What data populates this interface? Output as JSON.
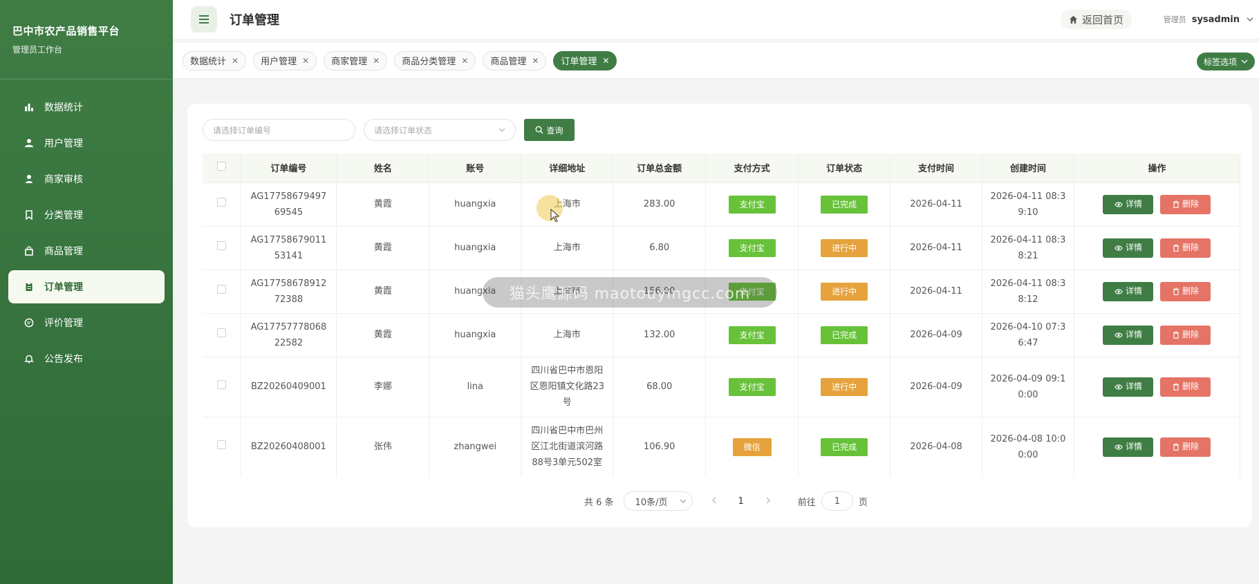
{
  "sidebar": {
    "title": "巴中市农产品销售平台",
    "subtitle": "管理员工作台",
    "items": [
      {
        "label": "数据统计",
        "icon": "bar-chart-icon"
      },
      {
        "label": "用户管理",
        "icon": "user-icon"
      },
      {
        "label": "商家审核",
        "icon": "merchant-icon"
      },
      {
        "label": "分类管理",
        "icon": "bookmark-icon"
      },
      {
        "label": "商品管理",
        "icon": "bag-icon"
      },
      {
        "label": "订单管理",
        "icon": "clipboard-icon",
        "active": true
      },
      {
        "label": "评价管理",
        "icon": "chat-icon"
      },
      {
        "label": "公告发布",
        "icon": "bell-icon"
      }
    ]
  },
  "header": {
    "title": "订单管理",
    "home_label": "返回首页",
    "role": "管理员",
    "username": "sysadmin"
  },
  "tags": {
    "items": [
      "数据统计",
      "用户管理",
      "商家管理",
      "商品分类管理",
      "商品管理",
      "订单管理"
    ],
    "active_index": 5,
    "options_label": "标签选项"
  },
  "filters": {
    "order_no_placeholder": "请选择订单编号",
    "status_placeholder": "请选择订单状态",
    "query_label": "查询"
  },
  "table": {
    "columns": [
      "订单编号",
      "姓名",
      "账号",
      "详细地址",
      "订单总金额",
      "支付方式",
      "订单状态",
      "支付时间",
      "创建时间",
      "操作"
    ],
    "rows": [
      {
        "order_no": "AG1775867949769545",
        "name": "黄霞",
        "account": "huangxia",
        "address": "上海市",
        "amount": "283.00",
        "pay_method": "支付宝",
        "status": "已完成",
        "pay_time": "2026-04-11",
        "created": "2026-04-11 08:39:10"
      },
      {
        "order_no": "AG1775867901153141",
        "name": "黄霞",
        "account": "huangxia",
        "address": "上海市",
        "amount": "6.80",
        "pay_method": "支付宝",
        "status": "进行中",
        "pay_time": "2026-04-11",
        "created": "2026-04-11 08:38:21"
      },
      {
        "order_no": "AG1775867891272388",
        "name": "黄霞",
        "account": "huangxia",
        "address": "上海市",
        "amount": "156.00",
        "pay_method": "支付宝",
        "status": "进行中",
        "pay_time": "2026-04-11",
        "created": "2026-04-11 08:38:12"
      },
      {
        "order_no": "AG1775777806822582",
        "name": "黄霞",
        "account": "huangxia",
        "address": "上海市",
        "amount": "132.00",
        "pay_method": "支付宝",
        "status": "已完成",
        "pay_time": "2026-04-09",
        "created": "2026-04-10 07:36:47"
      },
      {
        "order_no": "BZ20260409001",
        "name": "李娜",
        "account": "lina",
        "address": "四川省巴中市恩阳区恩阳镇文化路23号",
        "amount": "68.00",
        "pay_method": "支付宝",
        "status": "进行中",
        "pay_time": "2026-04-09",
        "created": "2026-04-09 09:10:00"
      },
      {
        "order_no": "BZ20260408001",
        "name": "张伟",
        "account": "zhangwei",
        "address": "四川省巴中市巴州区江北街道滨河路88号3单元502室",
        "amount": "106.90",
        "pay_method": "微信",
        "status": "已完成",
        "pay_time": "2026-04-08",
        "created": "2026-04-08 10:00:00"
      }
    ],
    "detail_label": "详情",
    "delete_label": "删除"
  },
  "pagination": {
    "total_text": "共 6 条",
    "page_size": "10条/页",
    "current_page": "1",
    "goto_prefix": "前往",
    "goto_value": "1",
    "goto_suffix": "页"
  },
  "colors": {
    "primary": "#3f7d45",
    "success": "#67c23a",
    "warning": "#e6a23c",
    "danger": "#e57366"
  },
  "watermark": "猫头鹰源码 maotouyingcc.com"
}
